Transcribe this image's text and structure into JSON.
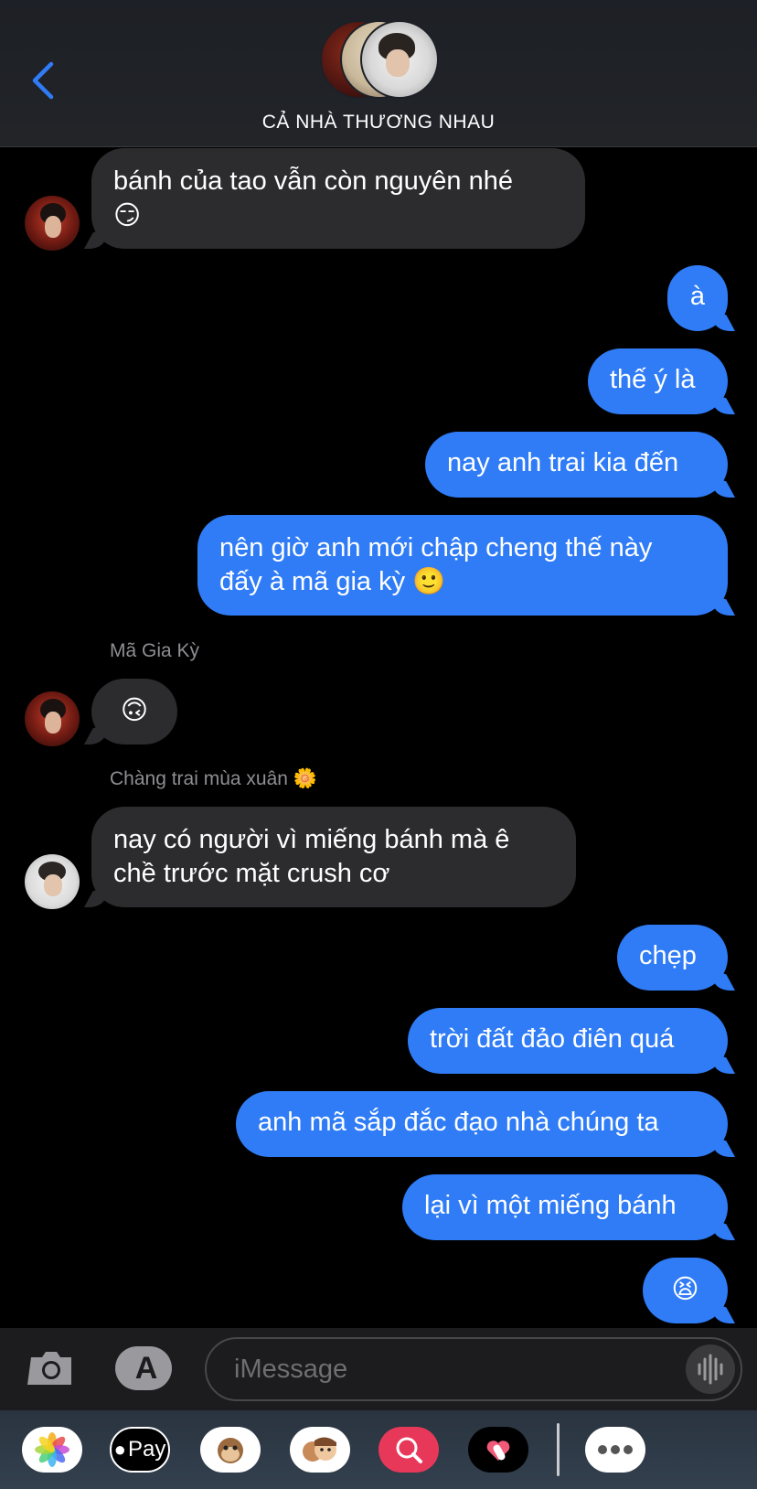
{
  "header": {
    "group_name": "CẢ NHÀ THƯƠNG NHAU",
    "back_icon": "chevron-left-icon"
  },
  "messages": [
    {
      "side": "in",
      "text": "bánh của tao vẫn còn nguyên nhé",
      "emoji": "😏"
    },
    {
      "side": "out",
      "text": "à"
    },
    {
      "side": "out",
      "text": "thế ý là"
    },
    {
      "side": "out",
      "text": "nay anh trai kia đến"
    },
    {
      "side": "out",
      "text": "nên giờ anh mới chập cheng thế này",
      "text2": "đấy à mã gia kỳ 🙂"
    },
    {
      "side": "in",
      "sender": "Mã Gia Kỳ",
      "text": "🙃"
    },
    {
      "side": "in",
      "sender": "Chàng trai mùa xuân 🌼",
      "text": "nay có người vì miếng bánh mà ê",
      "text2": "chề trước mặt crush cơ"
    },
    {
      "side": "out",
      "text": "chẹp"
    },
    {
      "side": "out",
      "text": "trời đất đảo điên quá"
    },
    {
      "side": "out",
      "text": "anh mã sắp đắc đạo nhà chúng ta"
    },
    {
      "side": "out",
      "text": "lại vì một miếng bánh"
    },
    {
      "side": "out",
      "text": "😫"
    }
  ],
  "composer": {
    "placeholder": "iMessage",
    "camera_icon": "camera-icon",
    "apps_icon": "app-store-icon",
    "audio_icon": "waveform-icon"
  },
  "drawer": {
    "apps": [
      "photos-icon",
      "apple-pay-icon",
      "animoji-icon",
      "memoji-icon",
      "image-search-icon",
      "digital-touch-icon",
      "more-icon"
    ],
    "apple_pay_label": "Pay"
  },
  "colors": {
    "outgoing_bubble": "#2f7cf6",
    "incoming_bubble": "#2c2c2e",
    "background": "#000000",
    "accent": "#2f7cf6"
  }
}
